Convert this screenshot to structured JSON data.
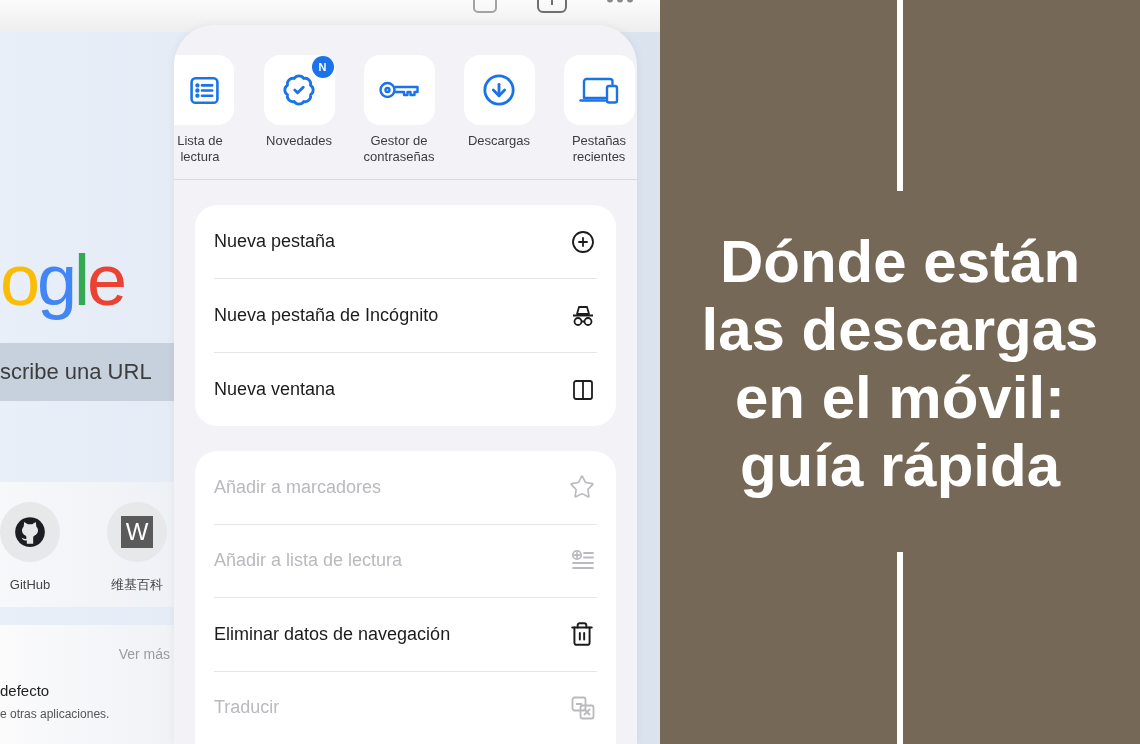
{
  "page": {
    "logo": "ogle",
    "search": {
      "placeholder": "scribe una URL"
    },
    "shortcuts": [
      {
        "label": "GitHub",
        "kind": "github"
      },
      {
        "label": "维基百科",
        "kind": "letter",
        "letter": "W"
      }
    ],
    "feed": {
      "link": "Ver más",
      "title": "defecto",
      "description": "e otras aplicaciones."
    }
  },
  "menu": {
    "quick_actions": [
      {
        "label": "Lista de lectura",
        "kind": "reading-list"
      },
      {
        "label": "Novedades",
        "kind": "whats-new",
        "badge": "N"
      },
      {
        "label": "Gestor de contraseñas",
        "kind": "passwords"
      },
      {
        "label": "Descargas",
        "kind": "downloads"
      },
      {
        "label": "Pestañas recientes",
        "kind": "recent-tabs"
      }
    ],
    "groups": [
      {
        "items": [
          {
            "label": "Nueva pestaña",
            "kind": "new-tab",
            "disabled": false
          },
          {
            "label": "Nueva pestaña de Incógnito",
            "kind": "incognito",
            "disabled": false
          },
          {
            "label": "Nueva ventana",
            "kind": "new-window",
            "disabled": false
          }
        ]
      },
      {
        "items": [
          {
            "label": "Añadir a marcadores",
            "kind": "bookmark",
            "disabled": true
          },
          {
            "label": "Añadir a lista de lectura",
            "kind": "reading-list",
            "disabled": true
          },
          {
            "label": "Eliminar datos de navegación",
            "kind": "clear-data",
            "disabled": false
          },
          {
            "label": "Traducir",
            "kind": "translate",
            "disabled": true
          }
        ]
      }
    ]
  },
  "cover": {
    "title": "Dónde están las descargas en el móvil: guía rápida"
  }
}
